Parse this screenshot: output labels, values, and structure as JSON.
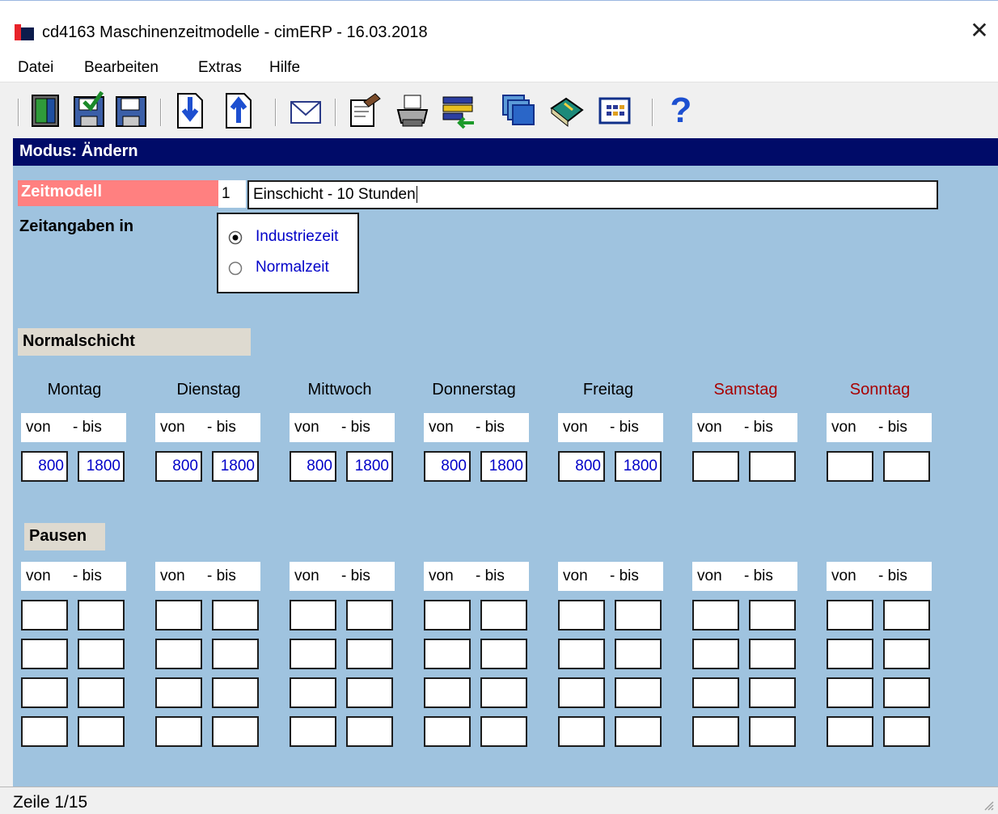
{
  "window": {
    "title": "cd4163 Maschinenzeitmodelle - cimERP - 16.03.2018",
    "close_glyph": "✕"
  },
  "menu": [
    "Datei",
    "Bearbeiten",
    "Extras",
    "Hilfe"
  ],
  "toolbar": {
    "icons": [
      "exit-icon",
      "save-close-icon",
      "save-icon",
      "import-icon",
      "export-icon",
      "mail-icon",
      "properties-icon",
      "print-icon",
      "list-transfer-icon",
      "windows-icon",
      "book-icon",
      "table-icon",
      "help-icon"
    ],
    "help_glyph": "?"
  },
  "mode": "Modus: Ändern",
  "form": {
    "zeitmodell_label": "Zeitmodell",
    "zeitmodell_nr": "1",
    "zeitmodell_name": "Einschicht - 10 Stunden",
    "zeitangaben_label": "Zeitangaben in",
    "radio_options": [
      {
        "label": "Industriezeit",
        "checked": true
      },
      {
        "label": "Normalzeit",
        "checked": false
      }
    ]
  },
  "normalschicht": {
    "label": "Normalschicht",
    "header_von": "von",
    "header_bis": "- bis",
    "days": [
      {
        "name": "Montag",
        "von": "800",
        "bis": "1800",
        "weekend": false
      },
      {
        "name": "Dienstag",
        "von": "800",
        "bis": "1800",
        "weekend": false
      },
      {
        "name": "Mittwoch",
        "von": "800",
        "bis": "1800",
        "weekend": false
      },
      {
        "name": "Donnerstag",
        "von": "800",
        "bis": "1800",
        "weekend": false
      },
      {
        "name": "Freitag",
        "von": "800",
        "bis": "1800",
        "weekend": false
      },
      {
        "name": "Samstag",
        "von": "",
        "bis": "",
        "weekend": true
      },
      {
        "name": "Sonntag",
        "von": "",
        "bis": "",
        "weekend": true
      }
    ]
  },
  "pausen": {
    "label": "Pausen",
    "header_von": "von",
    "header_bis": "- bis"
  },
  "status": "Zeile 1/15",
  "colors": {
    "form_bg": "#9fc3df",
    "mode_bar": "#000b68",
    "zeitmodell_label_bg": "#ff8080",
    "section_label_bg": "#dedad0",
    "weekend_text": "#a80000",
    "value_text": "#0000c8"
  }
}
